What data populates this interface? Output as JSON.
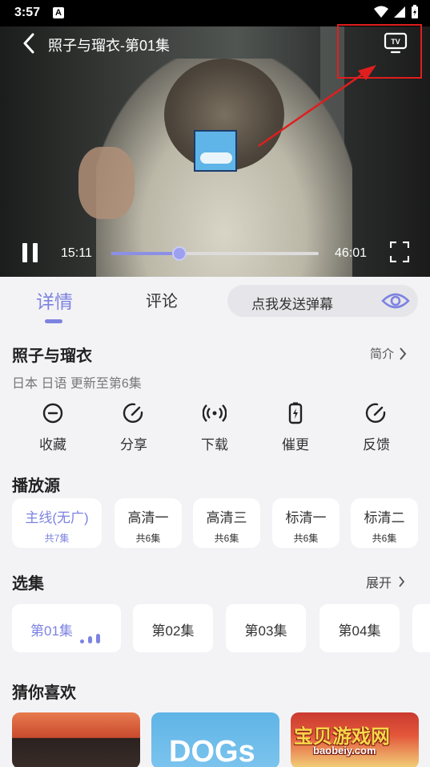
{
  "status_bar": {
    "time": "3:57",
    "badge": "A"
  },
  "video": {
    "title": "照子与瑠衣-第01集",
    "current_time": "15:11",
    "total_time": "46:01",
    "progress_fraction": 0.33,
    "tv_label": "TV"
  },
  "tabs": [
    {
      "label": "详情",
      "active": true
    },
    {
      "label": "评论",
      "active": false
    }
  ],
  "danmu": {
    "placeholder": "点我发送弹幕"
  },
  "show": {
    "title": "照子与瑠衣",
    "intro_label": "简介",
    "meta": "日本 日语 更新至第6集"
  },
  "actions": [
    {
      "label": "收藏",
      "icon": "minus-circle-icon"
    },
    {
      "label": "分享",
      "icon": "share-icon"
    },
    {
      "label": "下载",
      "icon": "download-signal-icon"
    },
    {
      "label": "催更",
      "icon": "battery-bolt-icon"
    },
    {
      "label": "反馈",
      "icon": "feedback-icon"
    }
  ],
  "sources_section": {
    "title": "播放源",
    "items": [
      {
        "name": "主线(无广)",
        "count": "共7集",
        "active": true
      },
      {
        "name": "高清一",
        "count": "共6集",
        "active": false
      },
      {
        "name": "高清三",
        "count": "共6集",
        "active": false
      },
      {
        "name": "标清一",
        "count": "共6集",
        "active": false
      },
      {
        "name": "标清二",
        "count": "共6集",
        "active": false
      }
    ]
  },
  "episodes_section": {
    "title": "选集",
    "expand_label": "展开",
    "items": [
      {
        "label": "第01集",
        "active": true
      },
      {
        "label": "第02集",
        "active": false
      },
      {
        "label": "第03集",
        "active": false
      },
      {
        "label": "第04集",
        "active": false
      }
    ]
  },
  "recommend_section": {
    "title": "猜你喜欢",
    "items": [
      {
        "overlay_text": ""
      },
      {
        "overlay_text": "DOGs"
      },
      {
        "overlay_text": ""
      }
    ]
  },
  "watermark": {
    "text": "宝贝游戏网",
    "url": "baobeiy.com"
  },
  "colors": {
    "accent": "#7d83e0",
    "highlight_box": "#e01e1e",
    "background": "#f3f3f6"
  }
}
